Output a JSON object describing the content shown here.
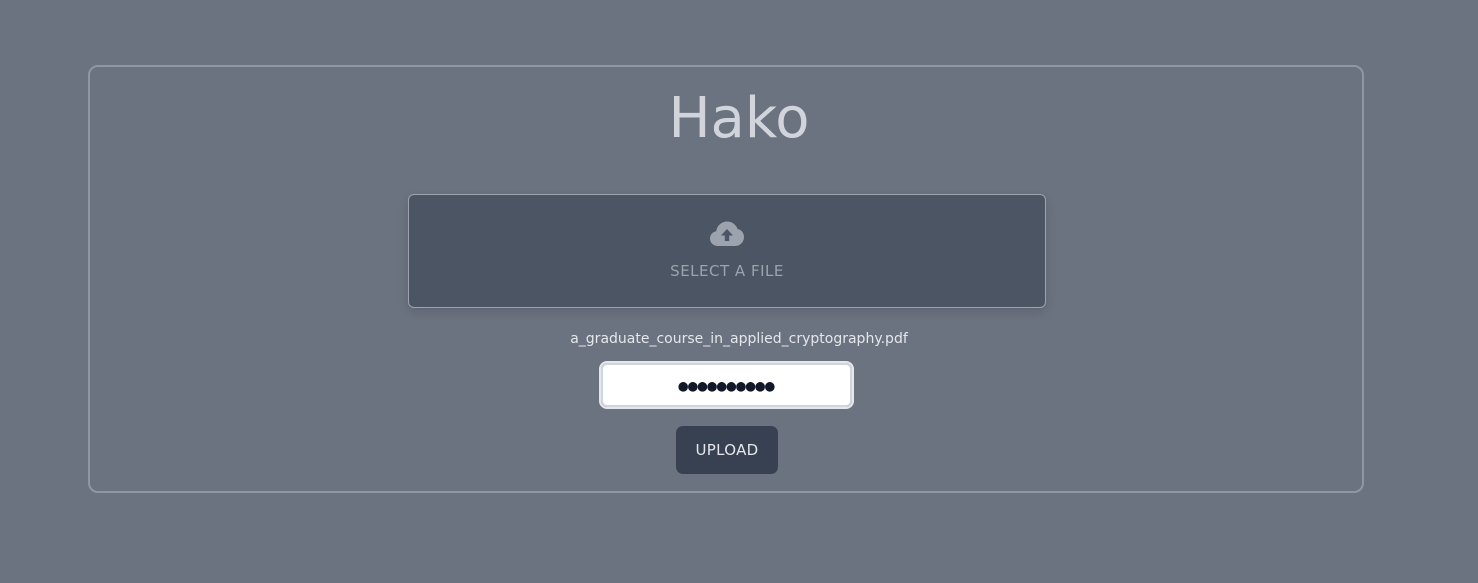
{
  "app": {
    "title": "Hako"
  },
  "dropzone": {
    "icon": "cloud-upload-icon",
    "label": "SELECT A FILE"
  },
  "selected_file": {
    "name": "a_graduate_course_in_applied_cryptography.pdf"
  },
  "password": {
    "value": "●●●●●●●●●●"
  },
  "upload_button": {
    "label": "UPLOAD"
  },
  "colors": {
    "background": "#6b7280",
    "card_border": "#9197a2",
    "dropzone_bg": "#4b5563",
    "button_bg": "#374151",
    "title_text": "#d1d5db"
  }
}
